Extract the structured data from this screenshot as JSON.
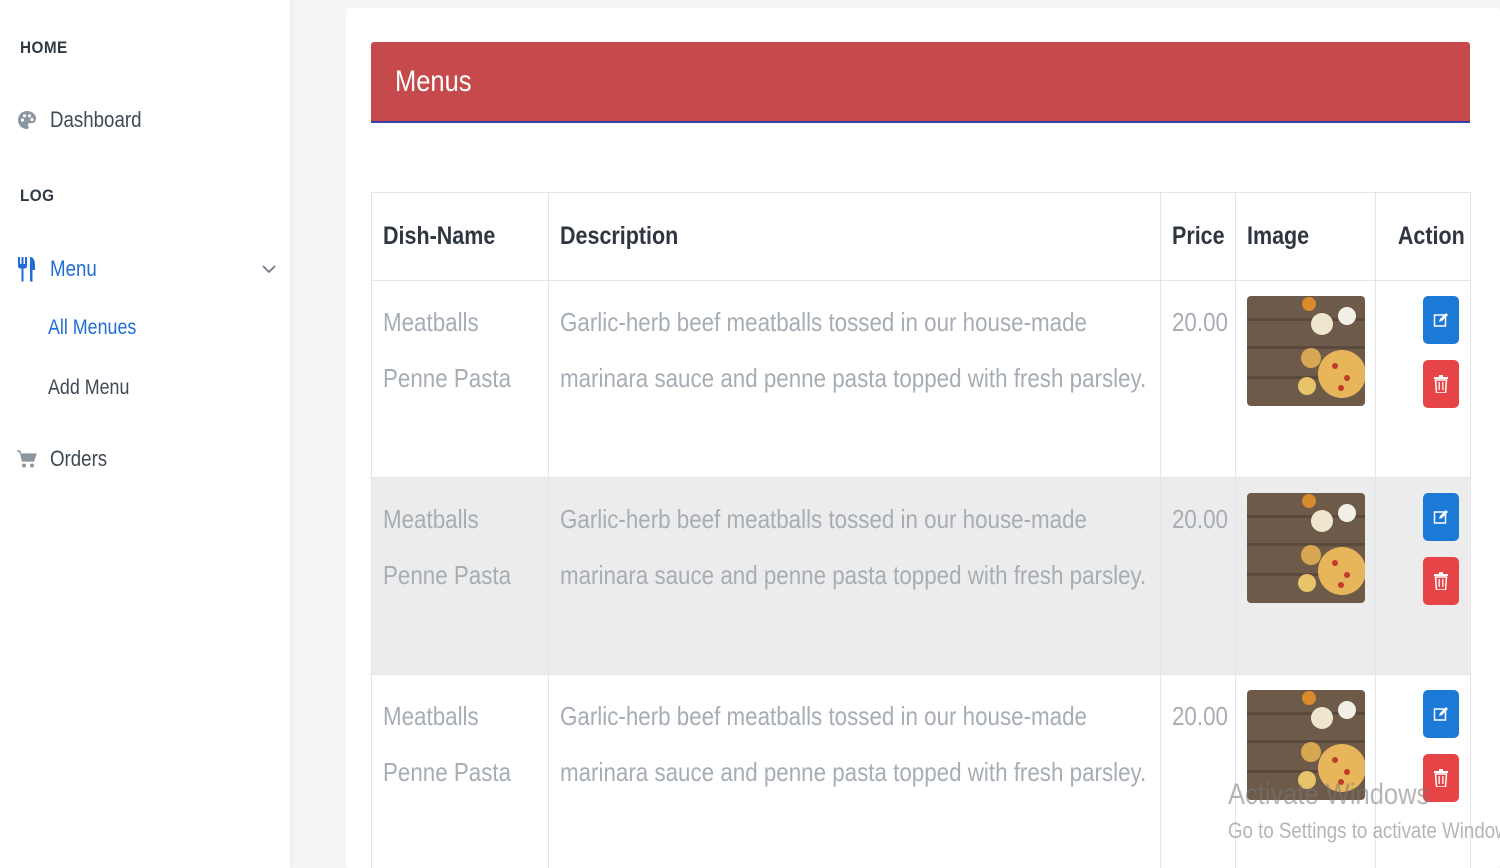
{
  "sidebar": {
    "sections": [
      "HOME",
      "LOG"
    ],
    "dashboard": {
      "label": "Dashboard",
      "icon": "palette-icon"
    },
    "menu": {
      "label": "Menu",
      "icon": "utensils-icon"
    },
    "sub_items": [
      "All Menues",
      "Add Menu"
    ],
    "orders": {
      "label": "Orders",
      "icon": "cart-icon"
    }
  },
  "main": {
    "title": "Menus",
    "columns": [
      "Dish-Name",
      "Description",
      "Price",
      "Image",
      "Action"
    ],
    "rows": [
      {
        "dish": "Meatballs Penne Pasta",
        "description": "Garlic-herb beef meatballs tossed in our house-made marinara sauce and penne pasta topped with fresh parsley.",
        "price": "20.00"
      },
      {
        "dish": "Meatballs Penne Pasta",
        "description": "Garlic-herb beef meatballs tossed in our house-made marinara sauce and penne pasta topped with fresh parsley.",
        "price": "20.00"
      },
      {
        "dish": "Meatballs Penne Pasta",
        "description": "Garlic-herb beef meatballs tossed in our house-made marinara sauce and penne pasta topped with fresh parsley.",
        "price": "20.00"
      }
    ]
  },
  "watermark": {
    "line1": "Activate Windows",
    "line2": "Go to Settings to activate Windows."
  },
  "colors": {
    "header": "#c64a4b",
    "accent": "#1f6dd6",
    "edit": "#1c79d6",
    "delete": "#e64446"
  }
}
